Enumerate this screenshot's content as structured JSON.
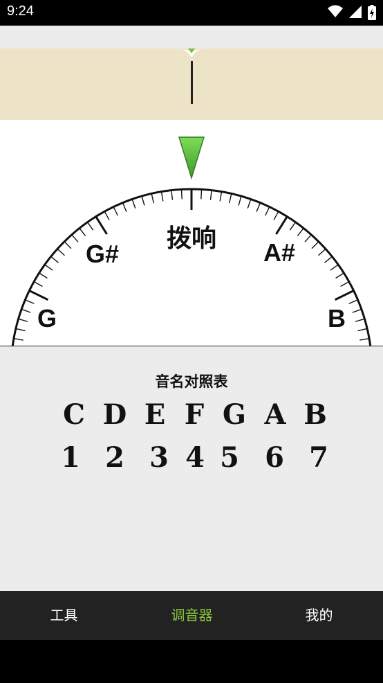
{
  "status_bar": {
    "time": "9:24",
    "icons": [
      "wifi-icon",
      "signal-icon",
      "battery-charging-icon"
    ]
  },
  "tuner": {
    "meter_marker_color": "#7bbf3a",
    "pointer_color": "#5cb93a",
    "notes": {
      "left": "G",
      "left_upper": "G#",
      "right_upper": "A#",
      "right": "B"
    },
    "status_text": "拨响"
  },
  "reference": {
    "title": "音名对照表",
    "note_names": [
      "C",
      "D",
      "E",
      "F",
      "G",
      "A",
      "B"
    ],
    "numbers": [
      "1",
      "2",
      "3",
      "4",
      "5",
      "6",
      "7"
    ]
  },
  "bottom_nav": {
    "items": [
      {
        "label": "工具",
        "active": false
      },
      {
        "label": "调音器",
        "active": true
      },
      {
        "label": "我的",
        "active": false
      }
    ],
    "active_color": "#8ac43f"
  }
}
